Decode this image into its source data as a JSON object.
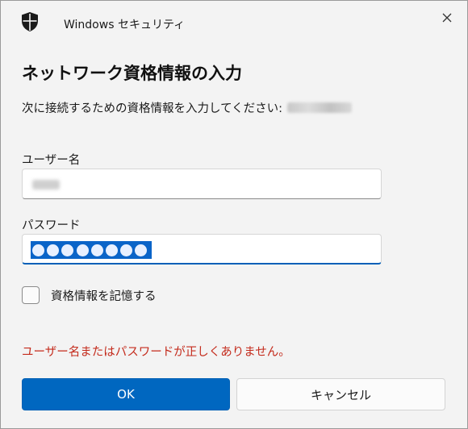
{
  "window": {
    "title": "Windows セキュリティ",
    "icon": "shield-icon",
    "close_icon": "close-icon"
  },
  "dialog": {
    "heading": "ネットワーク資格情報の入力",
    "prompt": "次に接続するための資格情報を入力してください:",
    "username": {
      "label": "ユーザー名",
      "value": ""
    },
    "password": {
      "label": "パスワード",
      "masked_value": "●●●●●●●●●"
    },
    "remember": {
      "label": "資格情報を記憶する",
      "checked": false
    },
    "error_message": "ユーザー名またはパスワードが正しくありません。",
    "error_color": "#c42b1c",
    "ok_label": "OK",
    "cancel_label": "キャンセル",
    "accent_color": "#0067c0"
  }
}
